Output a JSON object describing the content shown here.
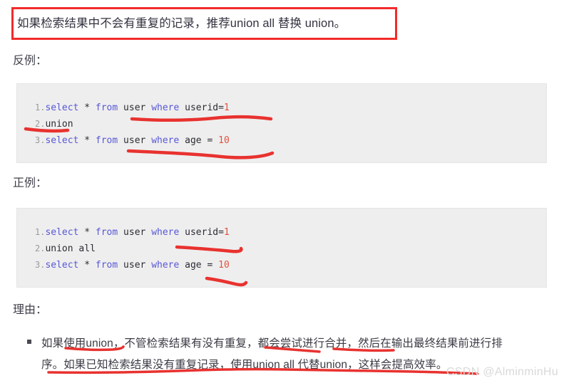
{
  "callout": {
    "text": "如果检索结果中不会有重复的记录，推荐union all 替换 union。",
    "border_color": "#f22b2b"
  },
  "labels": {
    "bad_example": "反例：",
    "good_example": "正例：",
    "reason": "理由："
  },
  "code_blocks": [
    {
      "name": "bad-example-code",
      "background": "#efeeee",
      "lines": [
        {
          "number": "1.",
          "tokens": [
            {
              "text": "select",
              "type": "keyword"
            },
            {
              "text": " * ",
              "type": "operator"
            },
            {
              "text": "from",
              "type": "keyword"
            },
            {
              "text": " user ",
              "type": "identifier"
            },
            {
              "text": "where",
              "type": "keyword"
            },
            {
              "text": " userid=",
              "type": "identifier"
            },
            {
              "text": "1",
              "type": "number"
            }
          ]
        },
        {
          "number": "2.",
          "tokens": [
            {
              "text": "union",
              "type": "identifier"
            }
          ]
        },
        {
          "number": "3.",
          "tokens": [
            {
              "text": "select",
              "type": "keyword"
            },
            {
              "text": " * ",
              "type": "operator"
            },
            {
              "text": "from",
              "type": "keyword"
            },
            {
              "text": " user ",
              "type": "identifier"
            },
            {
              "text": "where",
              "type": "keyword"
            },
            {
              "text": " age = ",
              "type": "identifier"
            },
            {
              "text": "10",
              "type": "number"
            }
          ]
        }
      ]
    },
    {
      "name": "good-example-code",
      "background": "#efeeee",
      "lines": [
        {
          "number": "1.",
          "tokens": [
            {
              "text": "select",
              "type": "keyword"
            },
            {
              "text": " * ",
              "type": "operator"
            },
            {
              "text": "from",
              "type": "keyword"
            },
            {
              "text": " user ",
              "type": "identifier"
            },
            {
              "text": "where",
              "type": "keyword"
            },
            {
              "text": " userid=",
              "type": "identifier"
            },
            {
              "text": "1",
              "type": "number"
            }
          ]
        },
        {
          "number": "2.",
          "tokens": [
            {
              "text": "union all",
              "type": "identifier"
            }
          ]
        },
        {
          "number": "3.",
          "tokens": [
            {
              "text": "select",
              "type": "keyword"
            },
            {
              "text": " * ",
              "type": "operator"
            },
            {
              "text": "from",
              "type": "keyword"
            },
            {
              "text": " user ",
              "type": "identifier"
            },
            {
              "text": "where",
              "type": "keyword"
            },
            {
              "text": " age = ",
              "type": "identifier"
            },
            {
              "text": "10",
              "type": "number"
            }
          ]
        }
      ]
    }
  ],
  "reason_list": [
    {
      "line1": "如果使用union，不管检索结果有没有重复，都会尝试进行合并，然后在输出最终结果前进行排",
      "line2": "序。如果已知检索结果没有重复记录，使用union all 代替union，这样会提高效率。"
    }
  ],
  "annotations": {
    "stroke_color": "#e8322f",
    "count": 9
  },
  "watermark": {
    "text": "CSDN @AlminminHu",
    "color": "#d9d9d9"
  }
}
